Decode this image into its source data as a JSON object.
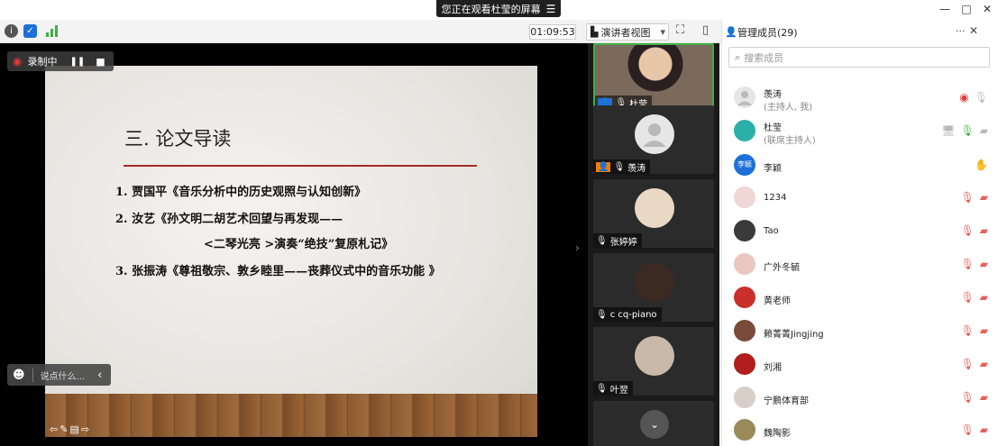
{
  "share_banner": {
    "text": "您正在观看杜莹的屏幕",
    "menu_icon": "menu-icon"
  },
  "window_controls": {
    "minimize": "—",
    "maximize": "□",
    "close": "✕"
  },
  "toolbar": {
    "timer": "01:09:53",
    "view_label": "演讲者视图",
    "view_caret": "▾",
    "fullscreen_glyph": "⛶",
    "panel_glyph": "▯"
  },
  "recording": {
    "label": "录制中",
    "pause_glyph": "❚❚",
    "stop_glyph": "■"
  },
  "comment": {
    "placeholder": "说点什么...",
    "arrow": "‹"
  },
  "slide": {
    "title": "三. 论文导读",
    "lines": [
      "1. 贾国平《音乐分析中的历史观照与认知创新》",
      "2. 汝艺《孙文明二胡艺术回望与再发现——",
      "<二琴光亮 >演奏“绝技”复原札记》",
      "3. 张振涛《尊祖敬宗、敦乡睦里——丧葬仪式中的音乐功能 》"
    ]
  },
  "thumbnails": [
    {
      "name": "杜莹"
    },
    {
      "name": "羡涛"
    },
    {
      "name": "张婷婷"
    },
    {
      "name": "c cq-piano"
    },
    {
      "name": "叶翌"
    }
  ],
  "panel": {
    "title": "管理成员(29)",
    "more": "···",
    "close": "✕",
    "search_placeholder": "搜索成员",
    "members": [
      {
        "name": "羡涛",
        "role": "(主持人, 我)",
        "avatar_color": "#e6e6e6"
      },
      {
        "name": "杜莹",
        "role": "(联席主持人)",
        "avatar_color": "#2bb0a8"
      },
      {
        "name": "李颖",
        "avatar_text": "李颖",
        "avatar_color": "#1e6fd9"
      },
      {
        "name": "1234",
        "avatar_color": "#f1d6d6"
      },
      {
        "name": "Tao",
        "avatar_color": "#3a3a3a"
      },
      {
        "name": "广外冬毓",
        "avatar_color": "#e8c8c0"
      },
      {
        "name": "黄老师",
        "avatar_color": "#c9302c"
      },
      {
        "name": "赖菁菁Jingjing",
        "avatar_color": "#7a4a3a"
      },
      {
        "name": "刘湘",
        "avatar_color": "#b01e1e"
      },
      {
        "name": "宁鹏体育部",
        "avatar_color": "#d8d0c8"
      },
      {
        "name": "魏陶影",
        "avatar_color": "#9a8a5a"
      }
    ]
  }
}
